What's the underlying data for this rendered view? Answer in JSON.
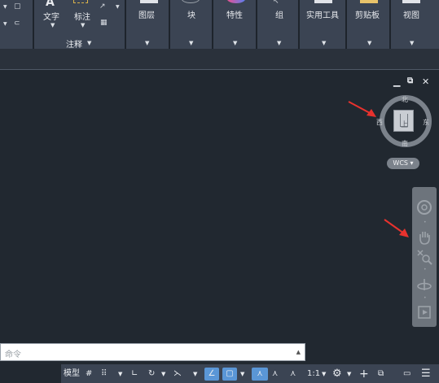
{
  "ribbon": {
    "text_label": "文字",
    "dimension_label": "标注",
    "annotation_group": "注释",
    "panels": [
      "图层",
      "块",
      "特性",
      "组",
      "实用工具",
      "剪贴板",
      "视图"
    ]
  },
  "viewcube": {
    "north": "北",
    "south": "南",
    "east": "东",
    "west": "西",
    "face": "上",
    "wcs": "WCS"
  },
  "command": {
    "placeholder": "命令"
  },
  "status": {
    "model": "模型",
    "scale": "1:1"
  }
}
